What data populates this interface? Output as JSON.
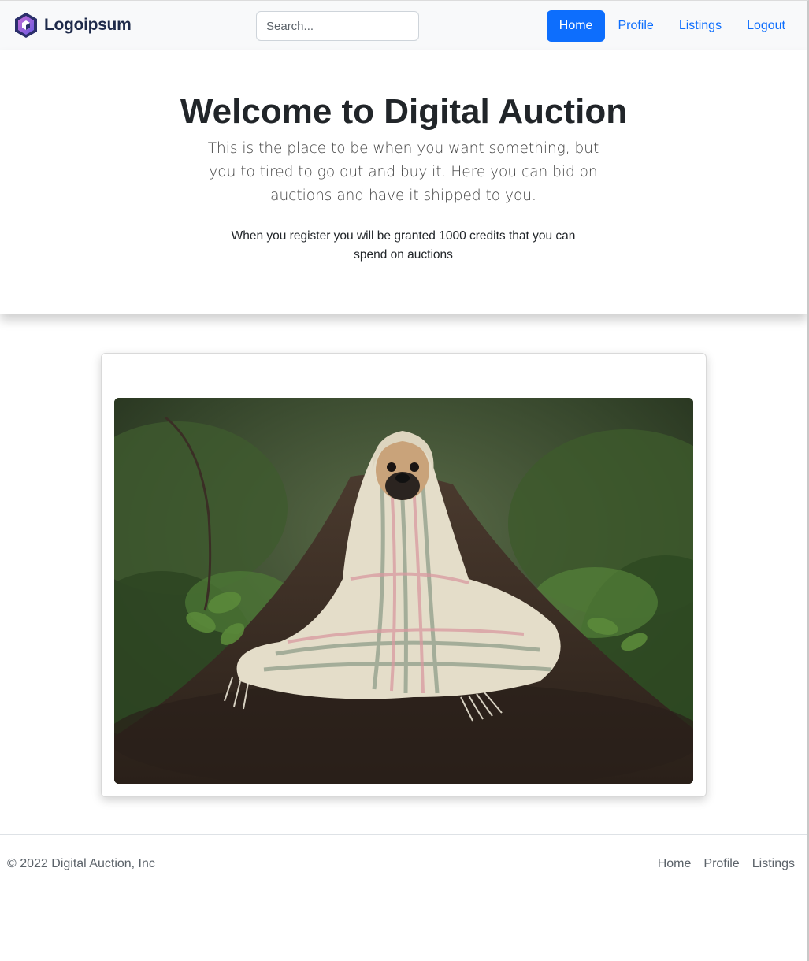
{
  "navbar": {
    "brand": "Logoipsum",
    "search_placeholder": "Search...",
    "links": [
      {
        "label": "Home",
        "active": true
      },
      {
        "label": "Profile",
        "active": false
      },
      {
        "label": "Listings",
        "active": false
      },
      {
        "label": "Logout",
        "active": false
      }
    ]
  },
  "hero": {
    "title": "Welcome to Digital Auction",
    "lead": "This is the place to be when you want something, but you to tired to go out and buy it. Here you can bid on auctions and have it shipped to you.",
    "note": "When you register you will be granted 1000 credits that you can spend on auctions"
  },
  "card": {
    "image_icon": "pug-in-blanket-photo"
  },
  "footer": {
    "copyright": "© 2022 Digital Auction, Inc",
    "links": [
      "Home",
      "Profile",
      "Listings"
    ]
  },
  "colors": {
    "primary": "#0d6efd",
    "navbar_bg": "#f8f9fa",
    "text_dark": "#212529",
    "text_muted": "#5c636a"
  }
}
